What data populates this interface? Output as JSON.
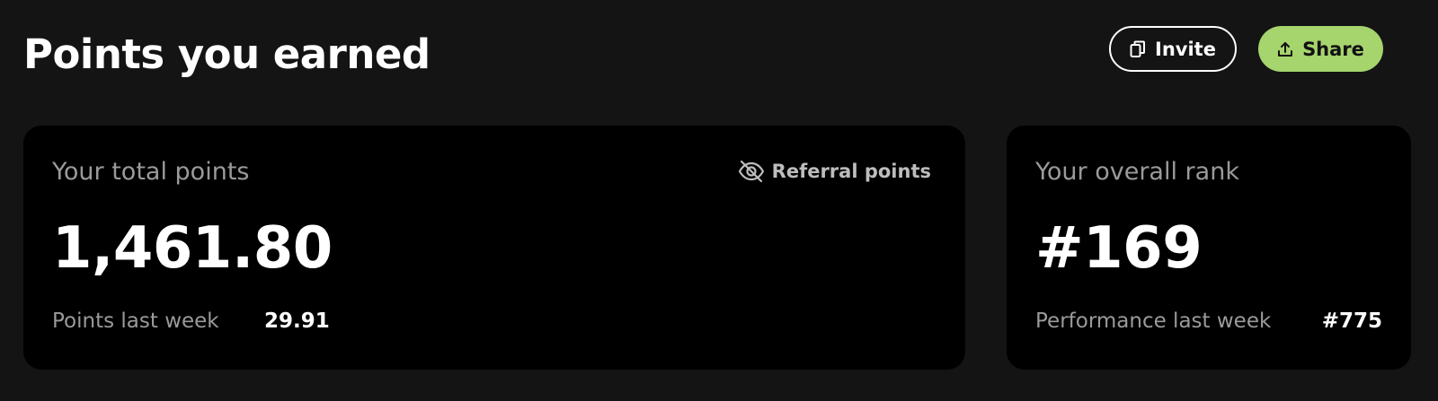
{
  "header": {
    "title": "Points you earned",
    "invite_label": "Invite",
    "share_label": "Share"
  },
  "total_points_card": {
    "label": "Your total points",
    "value": "1,461.80",
    "referral_toggle_label": "Referral points",
    "last_week_label": "Points last week",
    "last_week_value": "29.91"
  },
  "rank_card": {
    "label": "Your overall rank",
    "value": "#169",
    "last_week_label": "Performance last week",
    "last_week_value": "#775"
  },
  "icons": {
    "invite": "copy-icon",
    "share": "share-upload-icon",
    "referral": "eye-slash-icon"
  },
  "colors": {
    "background": "#141414",
    "card": "#000000",
    "accent": "#a6d46d",
    "muted_text": "#9a9a9a"
  }
}
